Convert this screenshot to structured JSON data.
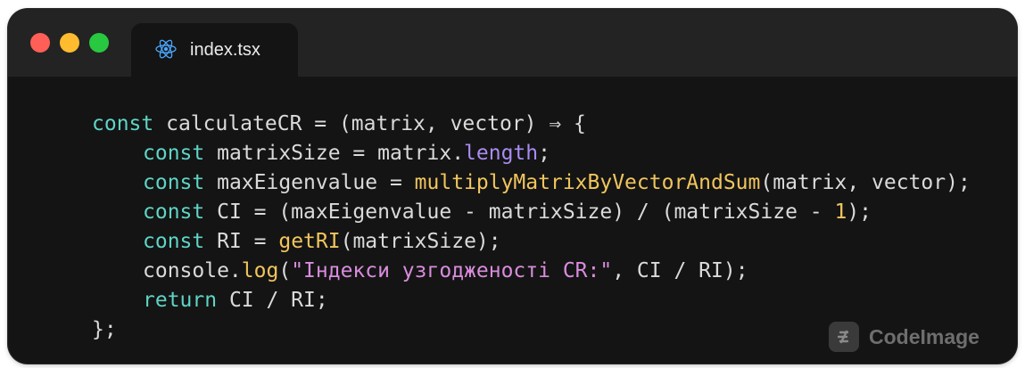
{
  "window": {
    "controls": {
      "close_color": "#ff5f57",
      "minimize_color": "#febc2e",
      "maximize_color": "#28c840"
    },
    "tab": {
      "icon": "react-icon",
      "label": "index.tsx"
    }
  },
  "code": {
    "lines": [
      [
        [
          "kw",
          "const"
        ],
        [
          "p",
          " calculateCR = (matrix, vector) ⇒ {"
        ]
      ],
      [
        [
          "i",
          ""
        ],
        [
          "kw",
          "const"
        ],
        [
          "p",
          " matrixSize = matrix."
        ],
        [
          "prop",
          "length"
        ],
        [
          "p",
          ";"
        ]
      ],
      [
        [
          "i",
          ""
        ],
        [
          "kw",
          "const"
        ],
        [
          "p",
          " maxEigenvalue = "
        ],
        [
          "fn",
          "multiplyMatrixByVectorAndSum"
        ],
        [
          "p",
          "(matrix, vector);"
        ]
      ],
      [
        [
          "i",
          ""
        ],
        [
          "kw",
          "const"
        ],
        [
          "p",
          " CI = (maxEigenvalue - matrixSize) / (matrixSize - "
        ],
        [
          "num",
          "1"
        ],
        [
          "p",
          ");"
        ]
      ],
      [
        [
          "i",
          ""
        ],
        [
          "kw",
          "const"
        ],
        [
          "p",
          " RI = "
        ],
        [
          "fn",
          "getRI"
        ],
        [
          "p",
          "(matrixSize);"
        ]
      ],
      [
        [
          "i",
          ""
        ],
        [
          "p",
          "console."
        ],
        [
          "fn",
          "log"
        ],
        [
          "p",
          "("
        ],
        [
          "str",
          "\"Індекси узгодженості CR:\""
        ],
        [
          "p",
          ", CI / RI);"
        ]
      ],
      [
        [
          "i",
          ""
        ],
        [
          "kw",
          "return"
        ],
        [
          "p",
          " CI / RI;"
        ]
      ],
      [
        [
          "p",
          "};"
        ]
      ]
    ]
  },
  "watermark": {
    "icon": "codeimage-logo-icon",
    "label": "CodeImage"
  }
}
